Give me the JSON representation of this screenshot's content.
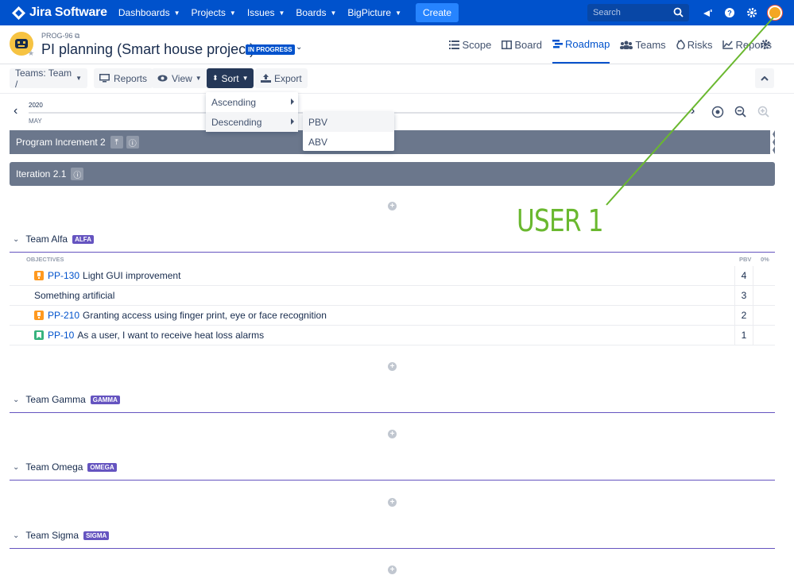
{
  "topnav": {
    "app_name": "Jira Software",
    "items": [
      "Dashboards",
      "Projects",
      "Issues",
      "Boards",
      "BigPicture"
    ],
    "create_label": "Create",
    "search_placeholder": "Search"
  },
  "header": {
    "project_key": "PROG-96",
    "title": "PI planning (Smart house project)",
    "status": "IN PROGRESS",
    "tabs": [
      "Scope",
      "Board",
      "Roadmap",
      "Teams",
      "Risks",
      "Reports"
    ],
    "active_tab": "Roadmap"
  },
  "toolbar": {
    "teams_label": "Teams: Team /",
    "reports_label": "Reports",
    "view_label": "View",
    "sort_label": "Sort",
    "export_label": "Export"
  },
  "sort_menu": {
    "items": [
      "Ascending",
      "Descending"
    ],
    "submenu": [
      "PBV",
      "ABV"
    ]
  },
  "timeline": {
    "year": "2020",
    "month": "MAY"
  },
  "increments": {
    "program_increment": "Program Increment 2",
    "iteration": "Iteration 2.1"
  },
  "objectives": {
    "header": "OBJECTIVES",
    "col_pbv": "PBV",
    "col_pct": "0%",
    "rows": [
      {
        "key": "PP-130",
        "summary": "Light GUI improvement",
        "pbv": "4",
        "icon": "orange-objective-icon"
      },
      {
        "key": "",
        "summary": "Something artificial",
        "pbv": "3",
        "icon": ""
      },
      {
        "key": "PP-210",
        "summary": "Granting access using finger print, eye or face recognition",
        "pbv": "2",
        "icon": "orange-objective-icon"
      },
      {
        "key": "PP-10",
        "summary": "As a user, I want to receive heat loss alarms",
        "pbv": "1",
        "icon": "green-story-icon"
      }
    ]
  },
  "teams": [
    {
      "name": "Team Alfa",
      "tag": "ALFA"
    },
    {
      "name": "Team Gamma",
      "tag": "GAMMA"
    },
    {
      "name": "Team Omega",
      "tag": "OMEGA"
    },
    {
      "name": "Team Sigma",
      "tag": "SIGMA"
    }
  ],
  "annotation": {
    "label": "USER 1",
    "color": "#6ab82f"
  },
  "colors": {
    "brand": "#0052cc",
    "team_tag": "#6554c0",
    "bar": "#6b778c"
  }
}
